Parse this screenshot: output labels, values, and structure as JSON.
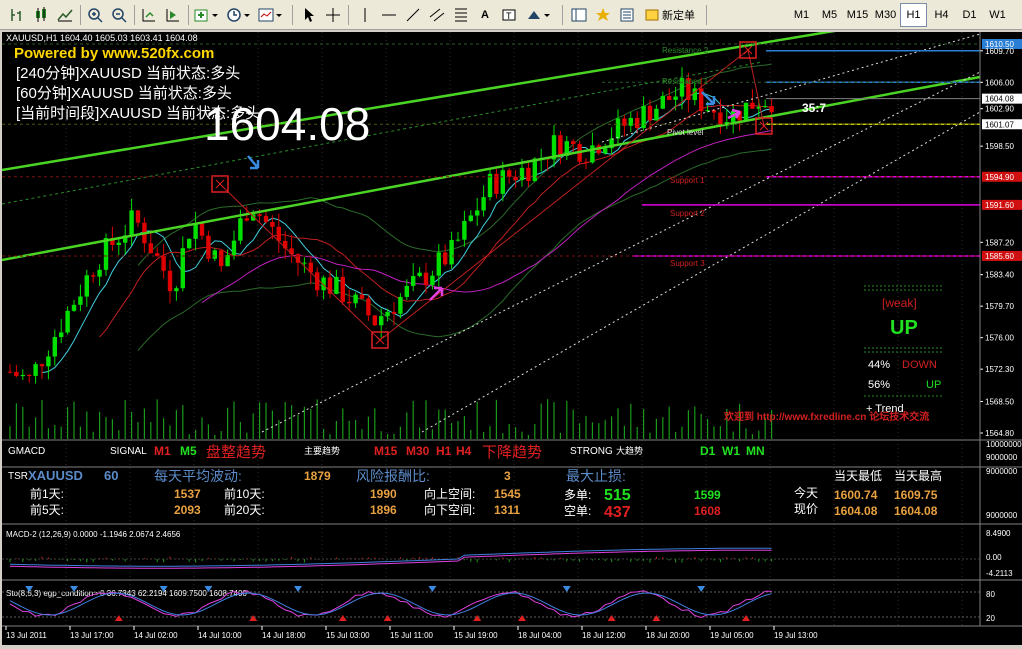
{
  "toolbar": {
    "new_order_label": "新定单",
    "timeframes": [
      "M1",
      "M5",
      "M15",
      "M30",
      "H1",
      "H4",
      "D1",
      "W1"
    ],
    "active_timeframe": "H1"
  },
  "chart": {
    "symbol_header": "XAUUSD,H1  1604.40 1605.03 1603.41 1604.08",
    "banner": "Powered by www.520fx.com",
    "status_240": "[240分钟]XAUUSD 当前状态:多头",
    "status_60": "[60分钟]XAUUSD 当前状态:多头",
    "status_current": "[当前时间段]XAUUSD 当前状态:多头",
    "big_price": "1604.08",
    "clock": "35:7",
    "price_axis": [
      {
        "label": "1610.50",
        "bg": "#2a7fd4"
      },
      {
        "label": "1609.70",
        "bg": ""
      },
      {
        "label": "1606.00",
        "bg": ""
      },
      {
        "label": "1604.08",
        "bg": "#ffffff"
      },
      {
        "label": "1602.90",
        "bg": ""
      },
      {
        "label": "1601.07",
        "bg": "#ffffff"
      },
      {
        "label": "1598.50",
        "bg": ""
      },
      {
        "label": "1594.90",
        "bg": "#d01010"
      },
      {
        "label": "1591.60",
        "bg": "#d01010"
      },
      {
        "label": "1587.20",
        "bg": ""
      },
      {
        "label": "1585.60",
        "bg": "#d01010"
      },
      {
        "label": "1583.40",
        "bg": ""
      },
      {
        "label": "1579.70",
        "bg": ""
      },
      {
        "label": "1576.00",
        "bg": ""
      },
      {
        "label": "1572.30",
        "bg": ""
      },
      {
        "label": "1568.50",
        "bg": ""
      },
      {
        "label": "1564.80",
        "bg": ""
      }
    ],
    "levels": {
      "r2": "Resistance 2",
      "r1": "Resistance 1",
      "pivot": "Pivot level",
      "s1": "Support 1",
      "s2": "Support 2",
      "s3": "Support 3"
    },
    "trend_box": {
      "weak": "[weak]",
      "direction": "UP",
      "down_pct": "44%",
      "down_label": "DOWN",
      "up_pct": "56%",
      "up_label": "UP",
      "trend_label": "+  Trend"
    },
    "welcome": "欢迎到 http://www.fxredline.cn 论坛技术交流"
  },
  "gmacd": {
    "title": "GMACD",
    "signal": "SIGNAL",
    "m1": "M1",
    "m5": "M5",
    "range_trend": "盘整趋势",
    "main_trend": "主要趋势",
    "m15": "M15",
    "m30": "M30",
    "h1": "H1",
    "h4": "H4",
    "down_trend": "下降趋势",
    "strong": "STRONG",
    "big_trend": "大趋势",
    "d1": "D1",
    "w1": "W1",
    "mn": "MN",
    "axis_top": "10000000",
    "axis_bottom": "9000000"
  },
  "tsr": {
    "title": "TSR",
    "symbol": "XAUUSD",
    "period": "60",
    "avg_label": "每天平均波动:",
    "avg_value": "1879",
    "rr_label": "风险报酬比:",
    "rr_value": "3",
    "sl_label": "最大止损:",
    "prev1_label": "前1天:",
    "prev1_value": "1537",
    "prev5_label": "前5天:",
    "prev5_value": "2093",
    "prev10_label": "前10天:",
    "prev10_value": "1990",
    "prev20_label": "前20天:",
    "prev20_value": "1896",
    "up_space_label": "向上空间:",
    "up_space_value": "1545",
    "down_space_label": "向下空间:",
    "down_space_value": "1311",
    "long_label": "多单:",
    "long_value": "515",
    "long_value2": "1599",
    "short_label": "空单:",
    "short_value": "437",
    "short_value2": "1608",
    "low_header": "当天最低",
    "high_header": "当天最高",
    "today_label": "今天",
    "today_low": "1600.74",
    "today_high": "1609.75",
    "now_label": "现价",
    "now_low": "1604.08",
    "now_high": "1604.08",
    "axis_top": "9000000",
    "axis_bottom": "9000000"
  },
  "macd": {
    "header": "MACD-2 (12,26,9) 0.0000 -1.1946 2.0674 2.4656",
    "axis": [
      "8.4900",
      "0.00",
      "-4.2113"
    ]
  },
  "sto": {
    "header": "Sto(8,5,3) egp_condition= 0   36.7343 62.2194 1609.7500 1608.7400",
    "axis": [
      "80",
      "20"
    ]
  },
  "time_axis": [
    "13 Jul 2011",
    "13 Jul 17:00",
    "14 Jul 02:00",
    "14 Jul 10:00",
    "14 Jul 18:00",
    "15 Jul 03:00",
    "15 Jul 11:00",
    "15 Jul 19:00",
    "18 Jul 04:00",
    "18 Jul 12:00",
    "18 Jul 20:00",
    "19 Jul 05:00",
    "19 Jul 13:00"
  ],
  "colors": {
    "bull": "#00e000",
    "bear": "#e00000",
    "trend_line": "#4ad423",
    "resistance": "#2a7fd4",
    "support": "#e000e0",
    "pivot": "#e8e800"
  }
}
